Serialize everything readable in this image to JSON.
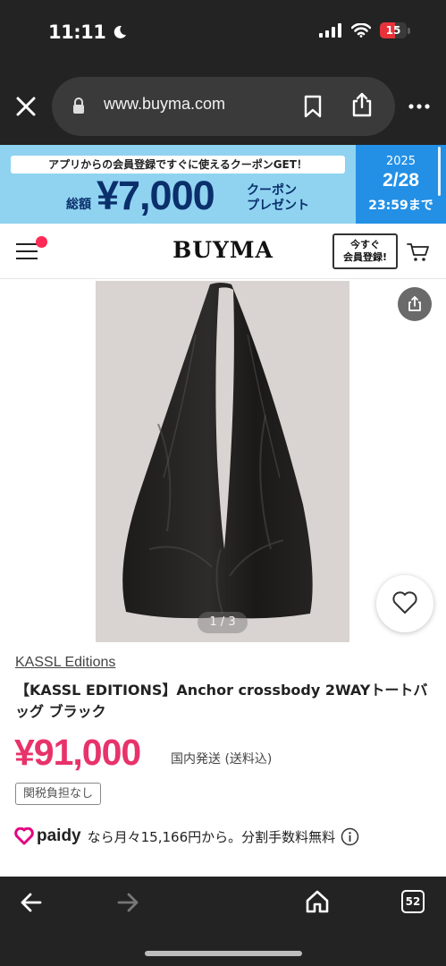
{
  "status_bar": {
    "time": "11:11",
    "battery_level": "15",
    "battery_fraction": 0.15,
    "battery_color": "#e8323a",
    "icons": [
      "moon-icon",
      "signal-icon",
      "wifi-icon",
      "battery-icon"
    ]
  },
  "browser": {
    "url": "www.buyma.com",
    "icons": [
      "close-icon",
      "lock-icon",
      "bookmark-icon",
      "share-icon",
      "more-icon"
    ]
  },
  "banner": {
    "top_text": "アプリからの会員登録ですぐに使えるクーポンGET！",
    "total_label": "総額",
    "amount": "¥7,000",
    "coupon_line1": "クーポン",
    "coupon_line2": "プレゼント",
    "year": "2025",
    "date": "2/28",
    "deadline": "23:59まで",
    "bg_color": "#8fd3f1",
    "accent_color": "#2390e6"
  },
  "site_header": {
    "logo": "BUYMA",
    "register_line1": "今すぐ",
    "register_line2": "会員登録!",
    "icons": [
      "menu-icon",
      "cart-icon"
    ],
    "notification_color": "#ff2a55"
  },
  "product": {
    "image_counter": "1 / 3",
    "brand": "KASSL Editions",
    "title": "【KASSL EDITIONS】Anchor crossbody 2WAYトートバッグ ブラック",
    "price": "¥91,000",
    "shipping": "国内発送 (送料込)",
    "tax_badge": "関税負担なし",
    "paidy_brand": "paidy",
    "paidy_text": "なら月々15,166円から。分割手数料無料",
    "price_color": "#e8336a",
    "icons": [
      "share-icon",
      "heart-icon",
      "info-icon",
      "paidy-logo-icon"
    ]
  },
  "toolbar": {
    "tab_count": "52",
    "icons": [
      "back-arrow-icon",
      "forward-arrow-icon",
      "home-icon",
      "tabs-icon"
    ]
  }
}
